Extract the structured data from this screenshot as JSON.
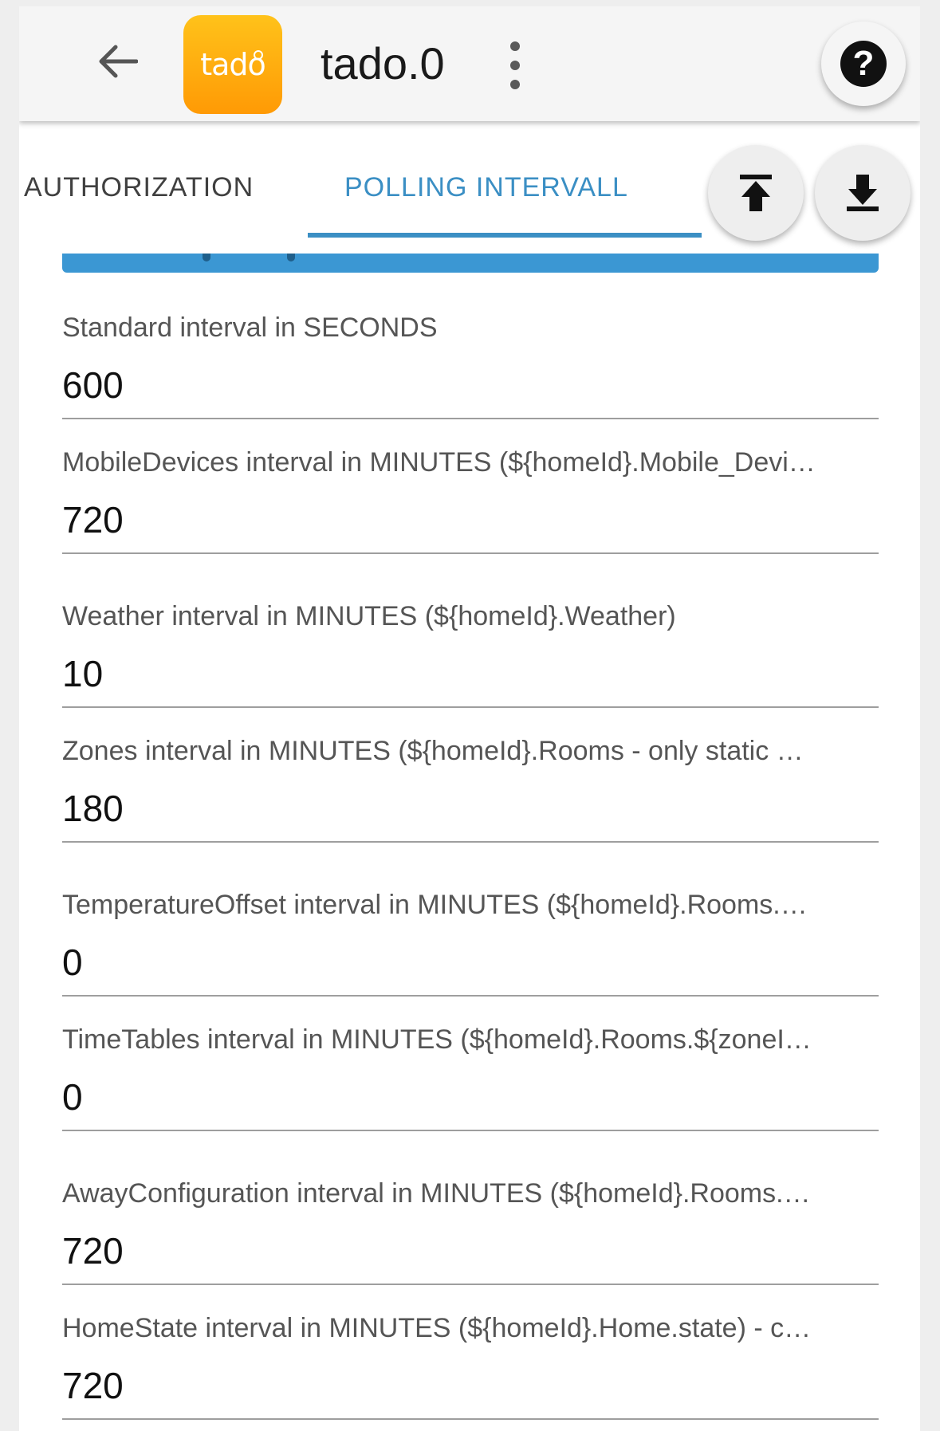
{
  "header": {
    "title": "tado.0",
    "logo_text": "tado",
    "help_glyph": "?"
  },
  "tabs": [
    {
      "label": "AUTHORIZATION",
      "active": false
    },
    {
      "label": "POLLING INTERVALL",
      "active": true
    }
  ],
  "colors": {
    "accent": "#3b8fc4",
    "logo_top": "#ffc21a",
    "logo_bottom": "#ff9a05"
  },
  "icons": {
    "back": "arrow-left-icon",
    "menu": "more-vertical-icon",
    "help": "help-circle-icon",
    "upload": "upload-icon",
    "download": "download-icon"
  },
  "fields": [
    {
      "label": "Standard interval in SECONDS",
      "value": "600"
    },
    {
      "label": "MobileDevices interval in MINUTES (${homeId}.Mobile_Devi…",
      "value": "720"
    },
    {
      "label": "Weather interval in MINUTES (${homeId}.Weather)",
      "value": "10"
    },
    {
      "label": "Zones interval in MINUTES (${homeId}.Rooms - only static …",
      "value": "180"
    },
    {
      "label": "TemperatureOffset interval in MINUTES (${homeId}.Rooms.…",
      "value": "0"
    },
    {
      "label": "TimeTables interval in MINUTES (${homeId}.Rooms.${zoneI…",
      "value": "0"
    },
    {
      "label": "AwayConfiguration interval in MINUTES (${homeId}.Rooms.…",
      "value": "720"
    },
    {
      "label": "HomeState interval in MINUTES (${homeId}.Home.state) - c…",
      "value": "720"
    }
  ]
}
